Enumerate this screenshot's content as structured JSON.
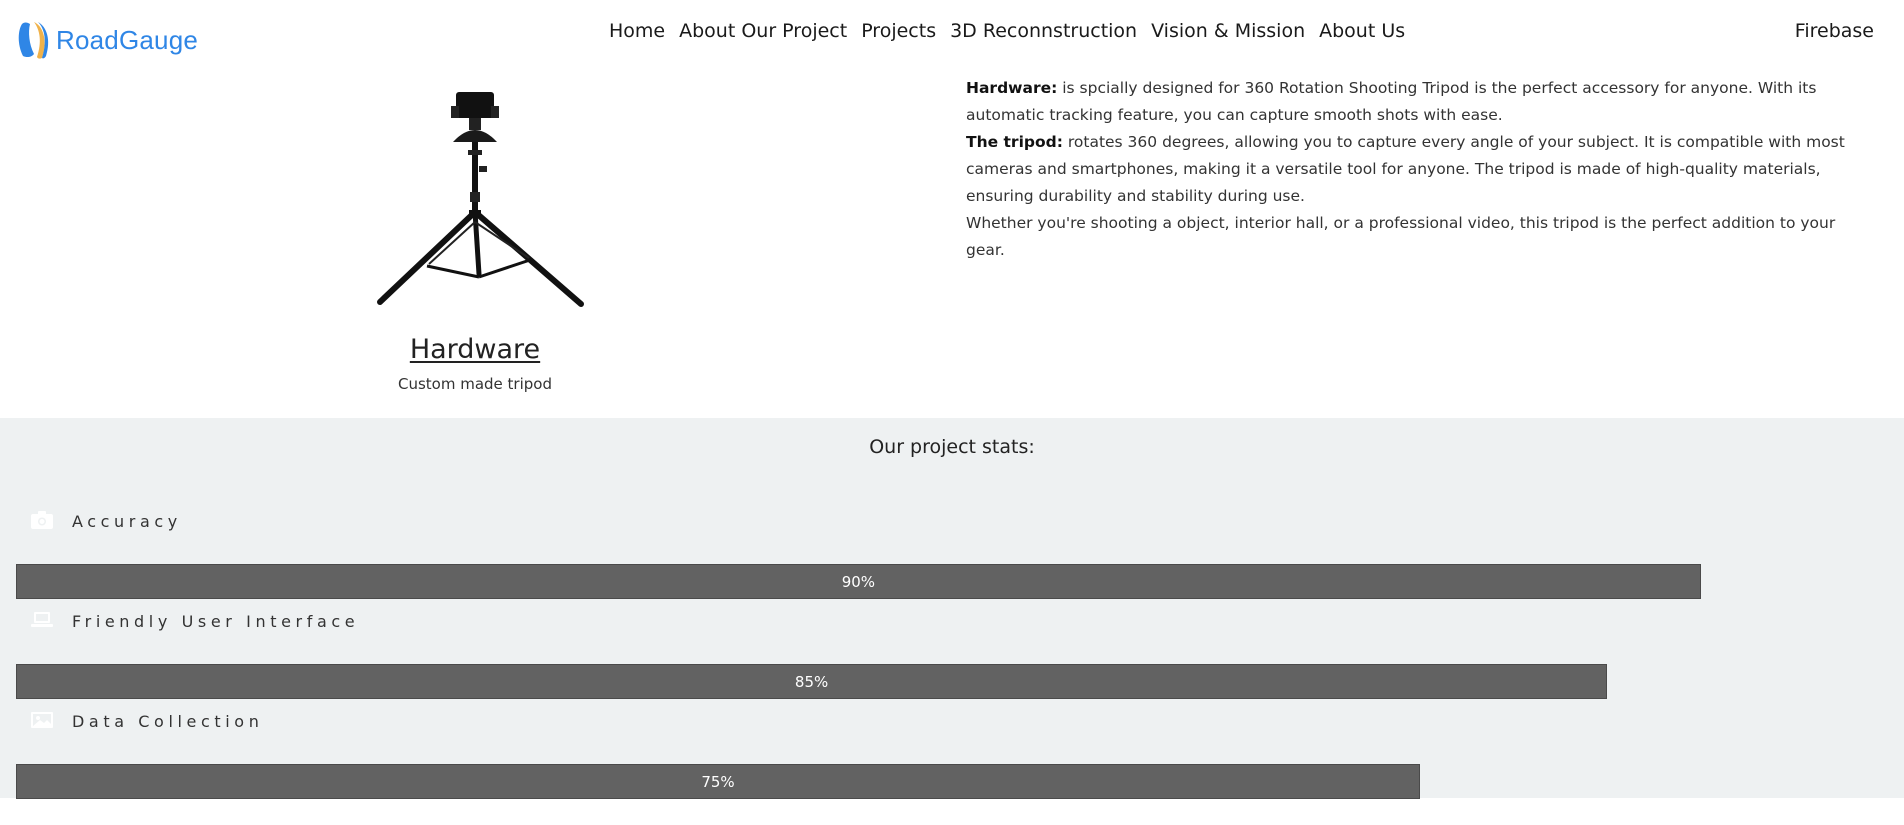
{
  "nav": {
    "brand": "RoadGauge",
    "links": [
      "Home",
      "About Our Project",
      "Projects",
      "3D Reconnstruction",
      "Vision & Mission",
      "About Us"
    ],
    "right_link": "Firebase"
  },
  "hardware": {
    "title": "Hardware",
    "subtitle": "Custom made tripod",
    "paragraphs": [
      {
        "strong": "Hardware:",
        "text": " is spcially designed for 360 Rotation Shooting Tripod is the perfect accessory for anyone. With its automatic tracking feature, you can capture smooth shots with ease."
      },
      {
        "strong": "The tripod:",
        "text": " rotates 360 degrees, allowing you to capture every angle of your subject. It is compatible with most cameras and smartphones, making it a versatile tool for anyone. The tripod is made of high-quality materials, ensuring durability and stability during use."
      },
      {
        "strong": "",
        "text": "Whether you're shooting a object, interior hall, or a professional video, this tripod is the perfect addition to your gear."
      }
    ]
  },
  "stats": {
    "title": "Our project stats:",
    "items": [
      {
        "label": "Accuracy",
        "value_text": "90%",
        "value": 90,
        "icon": "camera-icon"
      },
      {
        "label": "Friendly User Interface",
        "value_text": "85%",
        "value": 85,
        "icon": "laptop-icon"
      },
      {
        "label": "Data Collection",
        "value_text": "75%",
        "value": 75,
        "icon": "image-icon"
      }
    ]
  },
  "colors": {
    "brand": "#2f86e6",
    "bar": "#626262",
    "stats_bg": "#eef1f2"
  }
}
